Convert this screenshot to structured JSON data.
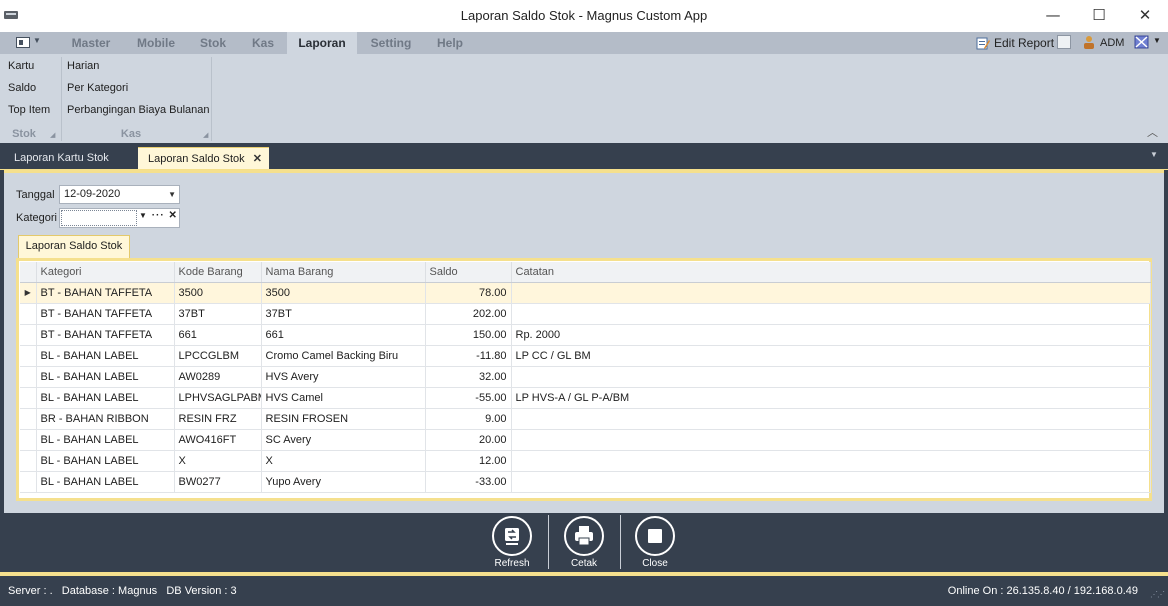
{
  "window": {
    "title": "Laporan Saldo Stok - Magnus Custom App",
    "minimize_glyph": "—",
    "maximize_glyph": "☐",
    "close_glyph": "✕"
  },
  "menu": {
    "tabs": [
      "Master",
      "Mobile",
      "Stok",
      "Kas",
      "Laporan",
      "Setting",
      "Help"
    ],
    "active_tab": "Laporan",
    "edit_report": "Edit Report",
    "user": "ADM"
  },
  "ribbon": {
    "stok_items": [
      "Kartu",
      "Saldo",
      "Top Item"
    ],
    "kas_items": [
      "Harian",
      "Per Kategori",
      "Perbangingan Biaya Bulanan"
    ],
    "groups": [
      "Stok",
      "Kas"
    ]
  },
  "doc_tabs": [
    "Laporan Kartu Stok",
    "Laporan Saldo Stok"
  ],
  "filters": {
    "tanggal_label": "Tanggal",
    "tanggal_value": "12-09-2020",
    "kategori_label": "Kategori",
    "kategori_value": ""
  },
  "inner_tab": "Laporan Saldo Stok",
  "table": {
    "columns": [
      "Kategori",
      "Kode Barang",
      "Nama Barang",
      "Saldo",
      "Catatan"
    ],
    "rows": [
      [
        "BT - BAHAN TAFFETA",
        "3500",
        "3500",
        "78.00",
        ""
      ],
      [
        "BT - BAHAN TAFFETA",
        "37BT",
        "37BT",
        "202.00",
        ""
      ],
      [
        "BT - BAHAN TAFFETA",
        "661",
        "661",
        "150.00",
        "Rp. 2000"
      ],
      [
        "BL - BAHAN LABEL",
        "LPCCGLBM",
        "Cromo Camel Backing Biru",
        "-11.80",
        "LP CC / GL BM"
      ],
      [
        "BL - BAHAN LABEL",
        "AW0289",
        "HVS Avery",
        "32.00",
        ""
      ],
      [
        "BL - BAHAN LABEL",
        "LPHVSAGLPABM",
        "HVS Camel",
        "-55.00",
        "LP HVS-A / GL P-A/BM"
      ],
      [
        "BR - BAHAN RIBBON",
        "RESIN FRZ",
        "RESIN FROSEN",
        "9.00",
        ""
      ],
      [
        "BL - BAHAN LABEL",
        "AWO416FT",
        "SC Avery",
        "20.00",
        ""
      ],
      [
        "BL - BAHAN LABEL",
        "X",
        "X",
        "12.00",
        ""
      ],
      [
        "BL - BAHAN LABEL",
        "BW0277",
        "Yupo Avery",
        "-33.00",
        ""
      ]
    ]
  },
  "actions": [
    "Refresh",
    "Cetak",
    "Close"
  ],
  "status": {
    "left": "Server : .   Database : Magnus   DB Version : 3",
    "right": "Online On : 26.135.8.40 / 192.168.0.49"
  }
}
